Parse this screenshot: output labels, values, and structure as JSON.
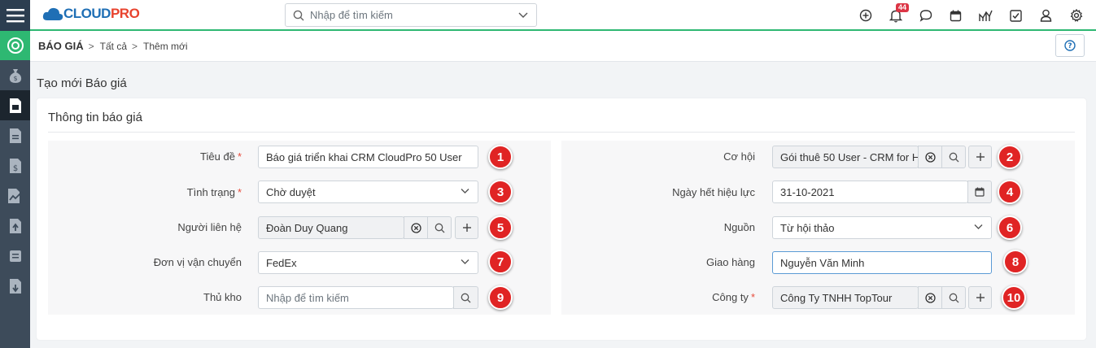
{
  "app": {
    "logo_part1": "CLOUD",
    "logo_part2": "PRO",
    "search_placeholder": "Nhập để tìm kiếm",
    "notification_count": "44",
    "accent_color": "#2eb872",
    "top_icons": [
      "add-circle-icon",
      "bell-icon",
      "chat-icon",
      "calendar-icon",
      "analytics-icon",
      "checkbox-icon",
      "user-icon",
      "gear-icon"
    ]
  },
  "sidebar": {
    "items": [
      "target-icon",
      "money-bag-icon",
      "quote-document-icon",
      "document-icon",
      "dollar-document-icon",
      "chart-document-icon",
      "upload-document-icon",
      "book-icon",
      "download-document-icon"
    ]
  },
  "breadcrumb": {
    "module": "BÁO GIÁ",
    "items": [
      "Tất cả",
      "Thêm mới"
    ],
    "separator": ">"
  },
  "page": {
    "title": "Tạo mới Báo giá",
    "section_title": "Thông tin báo giá"
  },
  "form": {
    "left": [
      {
        "label": "Tiêu đề",
        "required": "*",
        "value": "Báo giá triển khai CRM CloudPro 50 User",
        "type": "text",
        "marker": "1"
      },
      {
        "label": "Tình trạng",
        "required": "*",
        "value": "Chờ duyệt",
        "type": "select",
        "marker": "3"
      },
      {
        "label": "Người liên hệ",
        "required": "",
        "value": "Đoàn Duy Quang",
        "type": "reference",
        "marker": "5"
      },
      {
        "label": "Đơn vị vận chuyển",
        "required": "",
        "value": "FedEx",
        "type": "select",
        "marker": "7"
      },
      {
        "label": "Thủ kho",
        "required": "",
        "value": "",
        "placeholder": "Nhập để tìm kiếm",
        "type": "search",
        "marker": "9"
      }
    ],
    "right": [
      {
        "label": "Cơ hội",
        "required": "",
        "value": "Gói thuê 50 User - CRM for H",
        "type": "reference",
        "marker": "2"
      },
      {
        "label": "Ngày hết hiệu lực",
        "required": "",
        "value": "31-10-2021",
        "type": "date",
        "marker": "4"
      },
      {
        "label": "Nguồn",
        "required": "",
        "value": "Từ hội thảo",
        "type": "select",
        "marker": "6"
      },
      {
        "label": "Giao hàng",
        "required": "",
        "value": "Nguyễn Văn Minh",
        "type": "text",
        "marker": "8"
      },
      {
        "label": "Công ty",
        "required": "*",
        "value": "Công Ty TNHH TopTour",
        "type": "reference",
        "marker": "10"
      }
    ]
  }
}
